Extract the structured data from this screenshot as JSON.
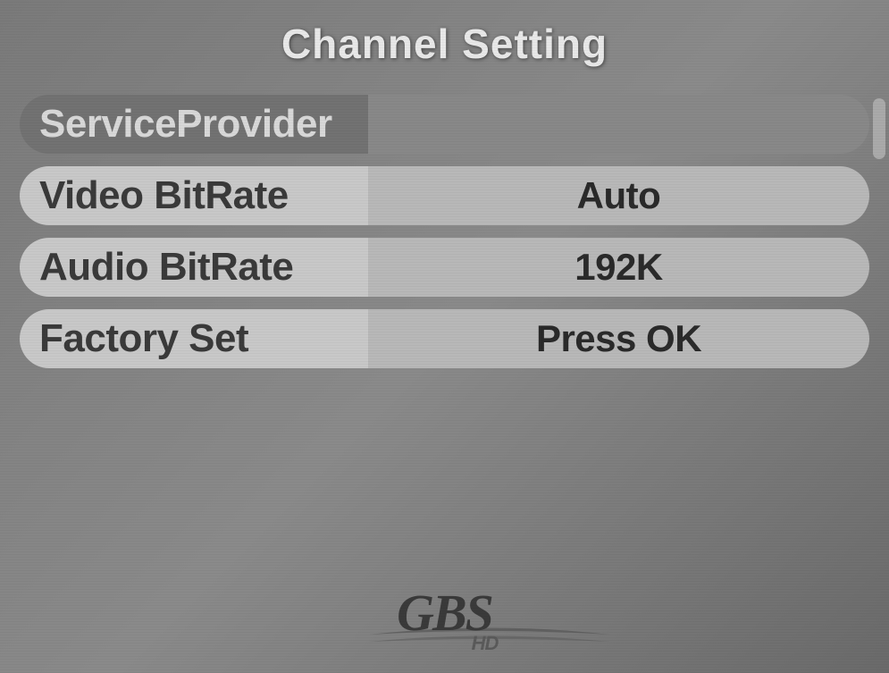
{
  "title": "Channel Setting",
  "menu": {
    "items": [
      {
        "label": "ServiceProvider",
        "value": "",
        "selected": true
      },
      {
        "label": "Video BitRate",
        "value": "Auto",
        "selected": false
      },
      {
        "label": "Audio BitRate",
        "value": "192K",
        "selected": false
      },
      {
        "label": "Factory Set",
        "value": "Press OK",
        "selected": false
      }
    ]
  },
  "logo": {
    "main": "GBS",
    "sub": "HD"
  }
}
